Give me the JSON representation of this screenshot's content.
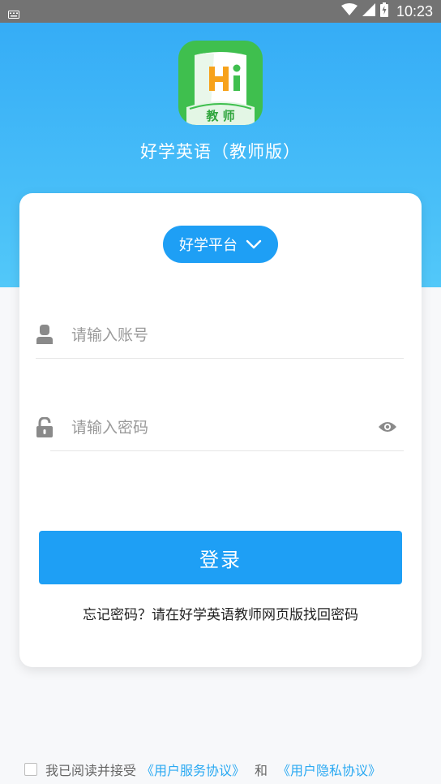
{
  "status_bar": {
    "time": "10:23",
    "icons": [
      "keyboard-icon",
      "wifi-icon",
      "signal-icon",
      "battery-icon"
    ]
  },
  "app": {
    "logo_text": "教 师",
    "name": "好学英语（教师版）"
  },
  "platform_selector": {
    "label": "好学平台"
  },
  "account_field": {
    "placeholder": "请输入账号",
    "value": ""
  },
  "password_field": {
    "placeholder": "请输入密码",
    "value": ""
  },
  "login_button": {
    "label": "登录"
  },
  "forgot_text": "忘记密码？请在好学英语教师网页版找回密码",
  "agreement": {
    "prefix": "我已阅读并接受",
    "service_link": "《用户服务协议》",
    "and": "和",
    "privacy_link": "《用户隐私协议》",
    "checked": false
  },
  "colors": {
    "accent": "#1e9ff5",
    "hero_top": "#33aaf6",
    "hero_bottom": "#52c8f9",
    "logo_green": "#3fbf4e",
    "link": "#2aa9f2"
  }
}
